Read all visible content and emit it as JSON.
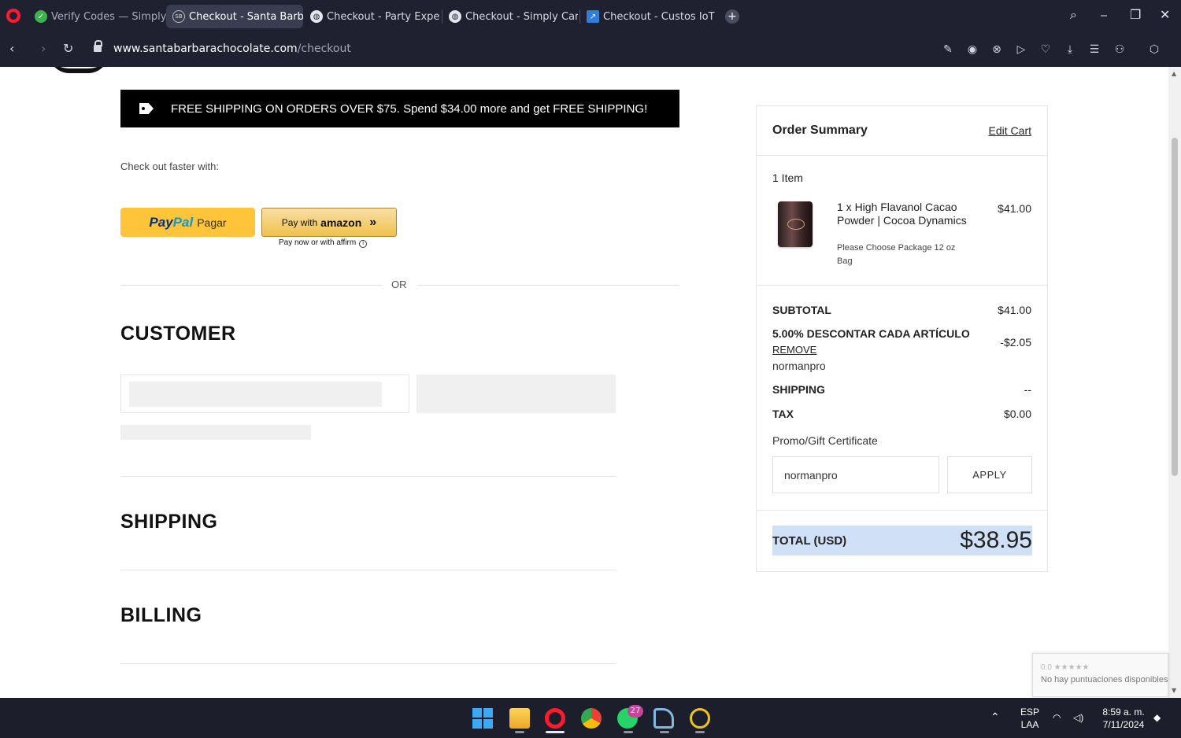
{
  "browser": {
    "tabs": [
      {
        "title": "Verify Codes — Simply",
        "active": false,
        "closable": true
      },
      {
        "title": "Checkout - Santa Barbara",
        "active": true
      },
      {
        "title": "Checkout - Party Expert",
        "active": false
      },
      {
        "title": "Checkout - Simply Carbon",
        "active": false
      },
      {
        "title": "Checkout - Custos IoT Sol",
        "active": false
      }
    ],
    "new_tab_label": "+",
    "url_domain": "www.santabarbarachocolate.com",
    "url_path": "/checkout",
    "colors": {
      "chrome": "#1f2130",
      "accent": "#ff1b2d"
    }
  },
  "page": {
    "banner": "FREE SHIPPING ON ORDERS OVER $75. Spend $34.00 more and get FREE SHIPPING!",
    "checkout_faster": "Check out faster with:",
    "paypal": {
      "brand_a": "Pay",
      "brand_b": "Pal",
      "label": "Pagar"
    },
    "amazon": {
      "prefix": "Pay with",
      "brand": "amazon",
      "chevrons": "»"
    },
    "affirm_note": "Pay now or with affirm",
    "or_label": "OR",
    "sections": {
      "customer": "CUSTOMER",
      "shipping": "SHIPPING",
      "billing": "BILLING"
    }
  },
  "summary": {
    "title": "Order Summary",
    "edit_cart": "Edit Cart",
    "item_count": "1 Item",
    "item": {
      "name": "1 x High Flavanol Cacao Powder | Cocoa Dynamics",
      "option": "Please Choose Package 12 oz Bag",
      "price": "$41.00"
    },
    "subtotal_label": "SUBTOTAL",
    "subtotal": "$41.00",
    "discount_label": "5.00% DESCONTAR CADA ARTÍCULO",
    "discount": "-$2.05",
    "remove_label": "REMOVE",
    "discount_code": "normanpro",
    "shipping_label": "SHIPPING",
    "shipping": "--",
    "tax_label": "TAX",
    "tax": "$0.00",
    "promo_label": "Promo/Gift Certificate",
    "promo_value": "normanpro",
    "apply_label": "APPLY",
    "total_label": "TOTAL (USD)",
    "total": "$38.95"
  },
  "recaptcha": {
    "rating": "0.0 ★★★★★",
    "text": "No hay puntuaciones disponibles"
  },
  "taskbar": {
    "whatsapp_badge": "27",
    "lang_top": "ESP",
    "lang_bottom": "LAA",
    "time": "8:59 a. m.",
    "date": "7/11/2024"
  }
}
